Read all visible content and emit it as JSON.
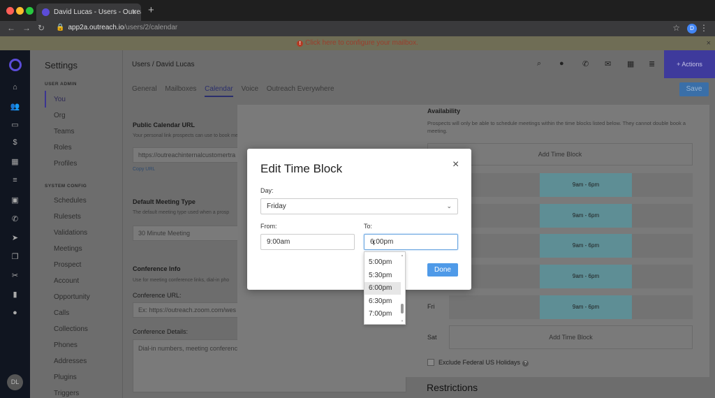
{
  "browser": {
    "tab_title": "David Lucas - Users - Outreach",
    "new_tab": "+",
    "url_host": "app2a.outreach.io",
    "url_path": "/users/2/calendar",
    "profile_initial": "D"
  },
  "banner": {
    "text": "Click here to configure your mailbox.",
    "close": "×"
  },
  "iconbar": {
    "avatar": "DL"
  },
  "settings": {
    "title": "Settings",
    "user_admin_label": "USER ADMIN",
    "user_admin_items": [
      "You",
      "Org",
      "Teams",
      "Roles",
      "Profiles"
    ],
    "system_config_label": "SYSTEM CONFIG",
    "system_config_items": [
      "Schedules",
      "Rulesets",
      "Validations",
      "Meetings",
      "Prospect",
      "Account",
      "Opportunity",
      "Calls",
      "Collections",
      "Phones",
      "Addresses",
      "Plugins",
      "Triggers"
    ]
  },
  "header": {
    "breadcrumb": "Users / David Lucas",
    "actions": "+ Actions",
    "save": "Save",
    "tabs": [
      "General",
      "Mailboxes",
      "Calendar",
      "Voice",
      "Outreach Everywhere"
    ]
  },
  "content": {
    "public_url_title": "Public Calendar URL",
    "public_url_desc": "Your personal link prospects can use to book meetings.",
    "public_url_value": "https://outreachinternalcustomertra",
    "copy_url": "Copy URL",
    "meeting_type_title": "Default Meeting Type",
    "meeting_type_desc": "The default meeting type used when a prosp",
    "meeting_type_value": "30 Minute Meeting",
    "conference_title": "Conference Info",
    "conference_desc": "Use for meeting conference links, dial-in pho",
    "conference_url_label": "Conference URL:",
    "conference_url_placeholder": "Ex: https://outreach.zoom.com/wes",
    "conference_details_label": "Conference Details:",
    "conference_details_placeholder": "Dial-in numbers, meeting conference ID's, etc."
  },
  "availability": {
    "title": "Availability",
    "desc": "Prospects will only be able to schedule meetings within the time blocks listed below. They cannot double book a meeting.",
    "add_time_block": "Add Time Block",
    "block_label": "9am - 6pm",
    "fri_label": "Fri",
    "sat_label": "Sat",
    "exclude_holidays": "Exclude Federal US Holidays",
    "help_icon": "?",
    "restrictions": "Restrictions"
  },
  "modal": {
    "title": "Edit Time Block",
    "close": "×",
    "day_label": "Day:",
    "day_value": "Friday",
    "from_label": "From:",
    "from_value": "9:00am",
    "to_label": "To:",
    "to_value": "6:00pm",
    "done": "Done",
    "dropdown_options": [
      "5:00pm",
      "5:30pm",
      "6:00pm",
      "6:30pm",
      "7:00pm"
    ],
    "dropdown_selected": "6:00pm"
  }
}
